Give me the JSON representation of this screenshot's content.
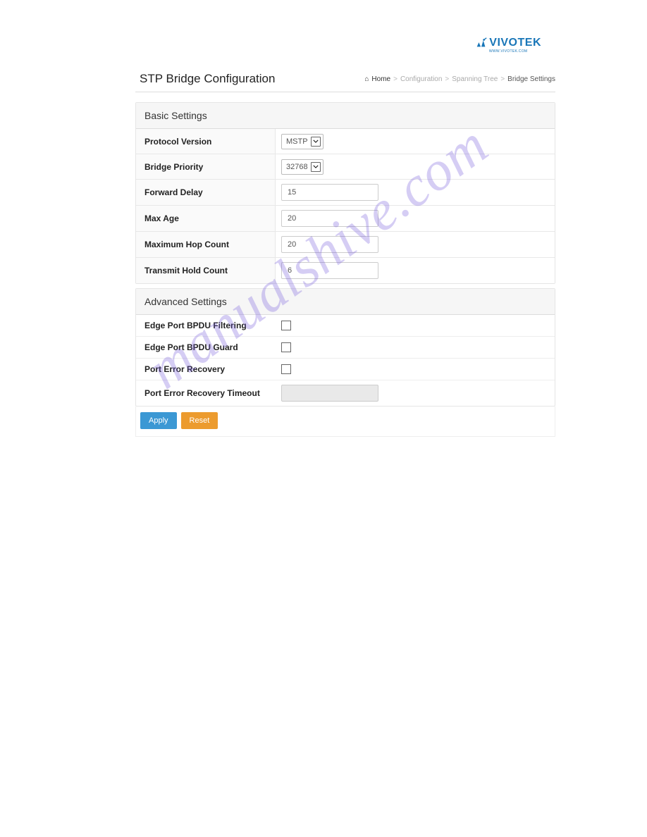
{
  "logo": {
    "brand": "VIVOTEK",
    "tagline": "WWW.VIVOTEK.COM"
  },
  "page": {
    "title": "STP Bridge Configuration"
  },
  "breadcrumb": {
    "home": "Home",
    "items": [
      "Configuration",
      "Spanning Tree",
      "Bridge Settings"
    ]
  },
  "basic": {
    "heading": "Basic Settings",
    "protocol_version": {
      "label": "Protocol Version",
      "value": "MSTP"
    },
    "bridge_priority": {
      "label": "Bridge Priority",
      "value": "32768"
    },
    "forward_delay": {
      "label": "Forward Delay",
      "value": "15"
    },
    "max_age": {
      "label": "Max Age",
      "value": "20"
    },
    "max_hop": {
      "label": "Maximum Hop Count",
      "value": "20"
    },
    "transmit_hold": {
      "label": "Transmit Hold Count",
      "value": "6"
    }
  },
  "advanced": {
    "heading": "Advanced Settings",
    "bpdu_filtering": {
      "label": "Edge Port BPDU Filtering"
    },
    "bpdu_guard": {
      "label": "Edge Port BPDU Guard"
    },
    "port_error_recovery": {
      "label": "Port Error Recovery"
    },
    "port_error_timeout": {
      "label": "Port Error Recovery Timeout",
      "value": ""
    }
  },
  "buttons": {
    "apply": "Apply",
    "reset": "Reset"
  },
  "watermark": "manualshive.com"
}
